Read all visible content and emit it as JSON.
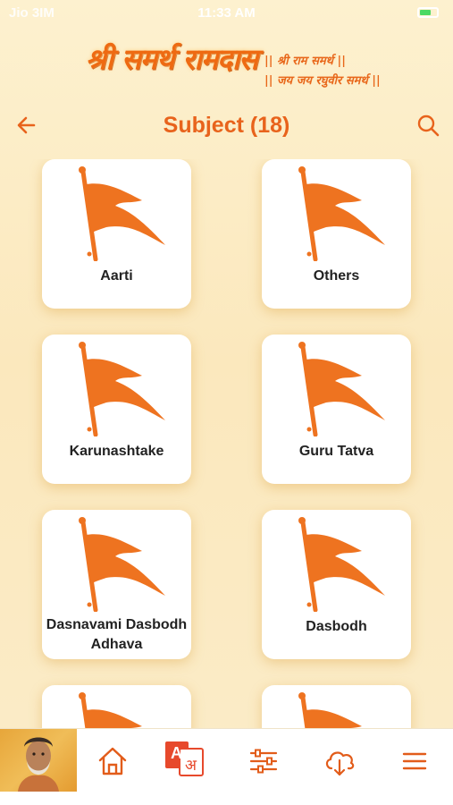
{
  "status": {
    "carrier": "Jio 3IM",
    "time": "11:33 AM"
  },
  "brand": {
    "title": "श्री समर्थ रामदास",
    "line1": "|| श्री राम समर्थ ||",
    "line2": "|| जय जय रघुवीर समर्थ ||"
  },
  "header": {
    "title": "Subject (18)"
  },
  "subjects": [
    {
      "label": "Aarti"
    },
    {
      "label": "Others"
    },
    {
      "label": "Karunashtake"
    },
    {
      "label": "Guru Tatva"
    },
    {
      "label": "Dasnavami Dasbodh Adhava"
    },
    {
      "label": "Dasbodh"
    },
    {
      "label": ""
    },
    {
      "label": ""
    }
  ],
  "nav": {
    "items": [
      "home-icon",
      "translate-icon",
      "filter-sliders-icon",
      "download-cloud-icon",
      "menu-icon"
    ],
    "translate_glyph_latin": "A",
    "translate_glyph_deva": "अ"
  },
  "colors": {
    "accent": "#e8631c",
    "flag": "#ee7320",
    "background": "#fdf1cf",
    "card": "#ffffff",
    "nav_icon": "#e25c1a"
  }
}
